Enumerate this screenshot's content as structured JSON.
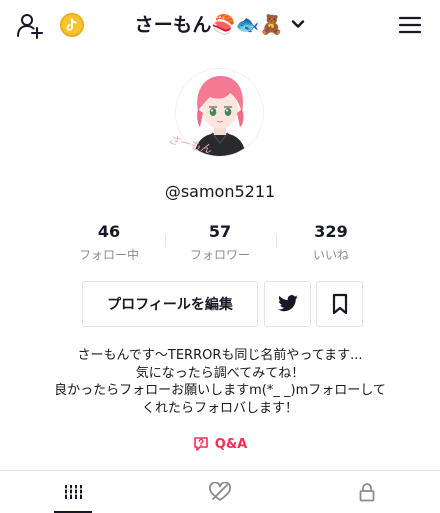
{
  "header": {
    "title": "さーもん🍣🐟🧸"
  },
  "profile": {
    "username": "@samon5211",
    "avatar_caption": "さーもん"
  },
  "stats": [
    {
      "value": "46",
      "label": "フォロー中"
    },
    {
      "value": "57",
      "label": "フォロワー"
    },
    {
      "value": "329",
      "label": "いいね"
    }
  ],
  "actions": {
    "edit_profile": "プロフィールを編集"
  },
  "bio": {
    "line1": "さーもんです〜TERRORも同じ名前やってます...",
    "line2": "気になったら調べてみてね！",
    "line3": "良かったらフォローお願いしますm(*_ _)mフォローして",
    "line4": "くれたらフォロバします！"
  },
  "qa": {
    "label": "Q&A"
  },
  "colors": {
    "accent": "#fe2c55",
    "coin": "#f7c42f",
    "text": "#161823",
    "muted": "#8a8b91"
  },
  "icons": {
    "add_user": "add-user-icon",
    "coin": "tiktok-coin-icon",
    "menu": "hamburger-menu-icon",
    "twitter": "twitter-icon",
    "bookmark": "bookmark-icon",
    "videos_tab": "grid-icon",
    "liked_tab": "hidden-heart-icon",
    "private_tab": "lock-icon"
  }
}
